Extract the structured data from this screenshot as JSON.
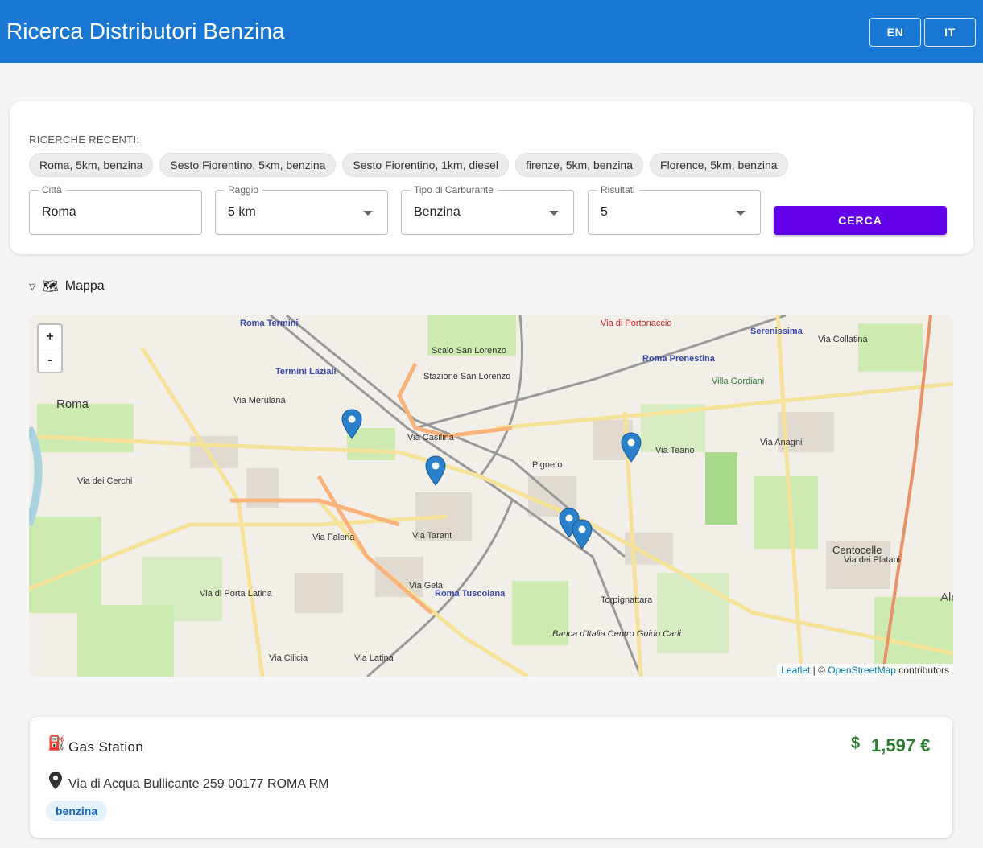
{
  "header": {
    "title": "Ricerca Distributori Benzina",
    "lang_en": "EN",
    "lang_it": "IT"
  },
  "search": {
    "recent_title": "RICERCHE RECENTI:",
    "recent": [
      "Roma, 5km, benzina",
      "Sesto Fiorentino, 5km, benzina",
      "Sesto Fiorentino, 1km, diesel",
      "firenze, 5km, benzina",
      "Florence, 5km, benzina"
    ],
    "city": {
      "label": "Città",
      "value": "Roma"
    },
    "radius": {
      "label": "Raggio",
      "value": "5 km"
    },
    "fuel": {
      "label": "Tipo di Carburante",
      "value": "Benzina"
    },
    "results": {
      "label": "Risultati",
      "value": "5"
    },
    "submit": "CERCA"
  },
  "map_section": {
    "toggle_icon": "▽",
    "map_icon": "🗺",
    "label": "Mappa",
    "zoom_in": "+",
    "zoom_out": "-",
    "attribution": {
      "leaflet": "Leaflet",
      "sep": " | © ",
      "osm": "OpenStreetMap",
      "tail": " contributors"
    },
    "places": [
      "Roma",
      "Roma Termini",
      "Termini Laziali",
      "Scalo San Lorenzo",
      "Stazione San Lorenzo",
      "Via di Portonaccio",
      "Serenissima",
      "Roma Prenestina",
      "Villa Gordiani",
      "Via Casilina",
      "Pigneto",
      "Via Teano",
      "Via Anagni",
      "Centocelle",
      "Via dei Platani",
      "Via Tarant",
      "Roma Tuscolana",
      "Torpignattara",
      "Via Merulana",
      "Via dei Cerchi",
      "Via Faleria",
      "Via di Porta Latina",
      "Via Latina",
      "Via Cilicia",
      "Via Gela",
      "Banca d'Italia Centro Guido Carli",
      "Via Collatina",
      "Ales"
    ]
  },
  "result": {
    "icon": "⛽",
    "name": "Gas Station",
    "price_icon": "$",
    "price": "1,597 €",
    "address": "Via di Acqua Bullicante 259 00177 ROMA RM",
    "fuel_badge": "benzina"
  },
  "colors": {
    "appbar": "#1976d2",
    "primary_button": "#6200ea",
    "price": "#2e7d32",
    "marker": "#2a81cb"
  }
}
